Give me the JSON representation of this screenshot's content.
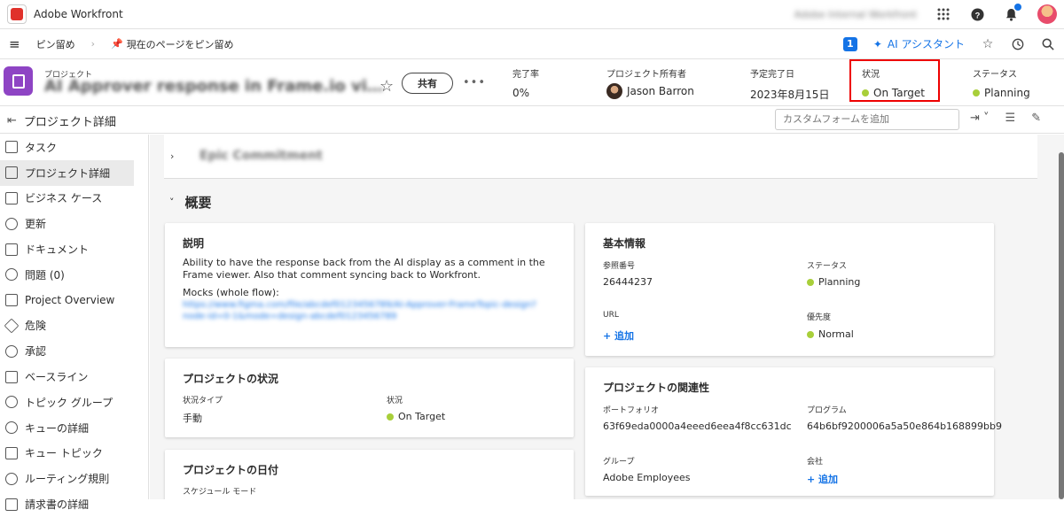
{
  "topbar": {
    "app_title": "Adobe Workfront",
    "user_label": "Adobe Internal Workfront"
  },
  "pinbar": {
    "pin_label": "ピン留め",
    "pin_page_label": "現在のページをピン留め",
    "notif_count": "1",
    "ai_label": "AI アシスタント"
  },
  "project": {
    "kicker": "プロジェクト",
    "name": "AI Approver response in Frame.io vi…",
    "share_label": "共有",
    "completion_label": "完了率",
    "completion_value": "0%",
    "owner_label": "プロジェクト所有者",
    "owner_value": "Jason Barron",
    "due_label": "予定完了日",
    "due_value": "2023年8月15日",
    "condition_label": "状況",
    "condition_value": "On Target",
    "status_label": "ステータス",
    "status_value": "Planning"
  },
  "subhead": {
    "title": "プロジェクト詳細",
    "custom_form_placeholder": "カスタムフォームを追加"
  },
  "sidebar": {
    "items": [
      {
        "label": "タスク"
      },
      {
        "label": "プロジェクト詳細"
      },
      {
        "label": "ビジネス ケース"
      },
      {
        "label": "更新"
      },
      {
        "label": "ドキュメント"
      },
      {
        "label": "問題 (0)"
      },
      {
        "label": "Project Overview"
      },
      {
        "label": "危険"
      },
      {
        "label": "承認"
      },
      {
        "label": "ベースライン"
      },
      {
        "label": "トピック グループ"
      },
      {
        "label": "キューの詳細"
      },
      {
        "label": "キュー トピック"
      },
      {
        "label": "ルーティング規則"
      },
      {
        "label": "請求書の詳細"
      }
    ]
  },
  "main": {
    "epic_label": "Epic Commitment",
    "overview_title": "概要",
    "description": {
      "title": "説明",
      "text": "Ability to have the response back from the AI display as a comment in the Frame viewer. Also that comment syncing back to Workfront.",
      "mocks_label": "Mocks (whole flow):",
      "mocks_link": "https://www.figma.com/file/abcdef0123456789/AI-Approver-FrameTopic-design?node-id=0-1&mode=design-abcdef0123456789"
    },
    "basic_info": {
      "title": "基本情報",
      "ref_label": "参照番号",
      "ref_value": "26444237",
      "status_label": "ステータス",
      "status_value": "Planning",
      "url_label": "URL",
      "url_add": "+ 追加",
      "priority_label": "優先度",
      "priority_value": "Normal"
    },
    "project_status": {
      "title": "プロジェクトの状況",
      "type_label": "状況タイプ",
      "type_value": "手動",
      "condition_label": "状況",
      "condition_value": "On Target"
    },
    "relations": {
      "title": "プロジェクトの関連性",
      "portfolio_label": "ポートフォリオ",
      "portfolio_value": "63f69eda0000a4eeed6eea4f8cc631dc",
      "program_label": "プログラム",
      "program_value": "64b6bf9200006a5a50e864b168899bb9",
      "group_label": "グループ",
      "group_value": "Adobe Employees",
      "company_label": "会社",
      "company_add": "+ 追加"
    },
    "dates": {
      "title": "プロジェクトの日付",
      "schedule_label": "スケジュール モード"
    }
  },
  "colors": {
    "accent": "#1473e6",
    "condition_dot": "#a8cf3a",
    "project_icon": "#8e44c4",
    "highlight_box": "#e00000"
  }
}
